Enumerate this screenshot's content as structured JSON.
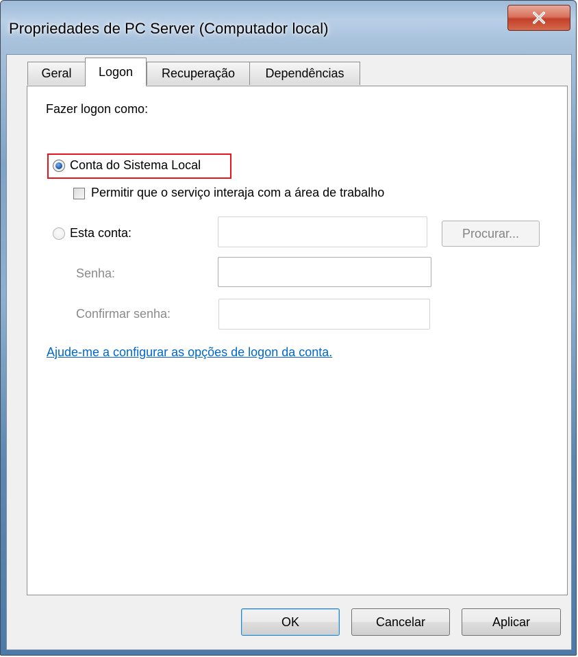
{
  "window": {
    "title": "Propriedades de PC Server (Computador local)"
  },
  "tabs": [
    {
      "label": "Geral",
      "active": false
    },
    {
      "label": "Logon",
      "active": true
    },
    {
      "label": "Recuperação",
      "active": false
    },
    {
      "label": "Dependências",
      "active": false
    }
  ],
  "logon": {
    "heading": "Fazer logon como:",
    "local_system_label": "Conta do Sistema Local",
    "local_system_selected": true,
    "interact_desktop_label": "Permitir que o serviço interaja com a área de trabalho",
    "interact_desktop_checked": false,
    "this_account_label": "Esta conta:",
    "this_account_selected": false,
    "account_value": "",
    "browse_label": "Procurar...",
    "password_label": "Senha:",
    "password_value": "",
    "confirm_password_label": "Confirmar senha:",
    "confirm_password_value": "",
    "help_link": "Ajude-me a configurar as opções de logon da conta."
  },
  "footer": {
    "ok_label": "OK",
    "cancel_label": "Cancelar",
    "apply_label": "Aplicar"
  },
  "colors": {
    "highlight": "#e8141c",
    "link": "#0066cc",
    "close_button": "#c3402a"
  }
}
